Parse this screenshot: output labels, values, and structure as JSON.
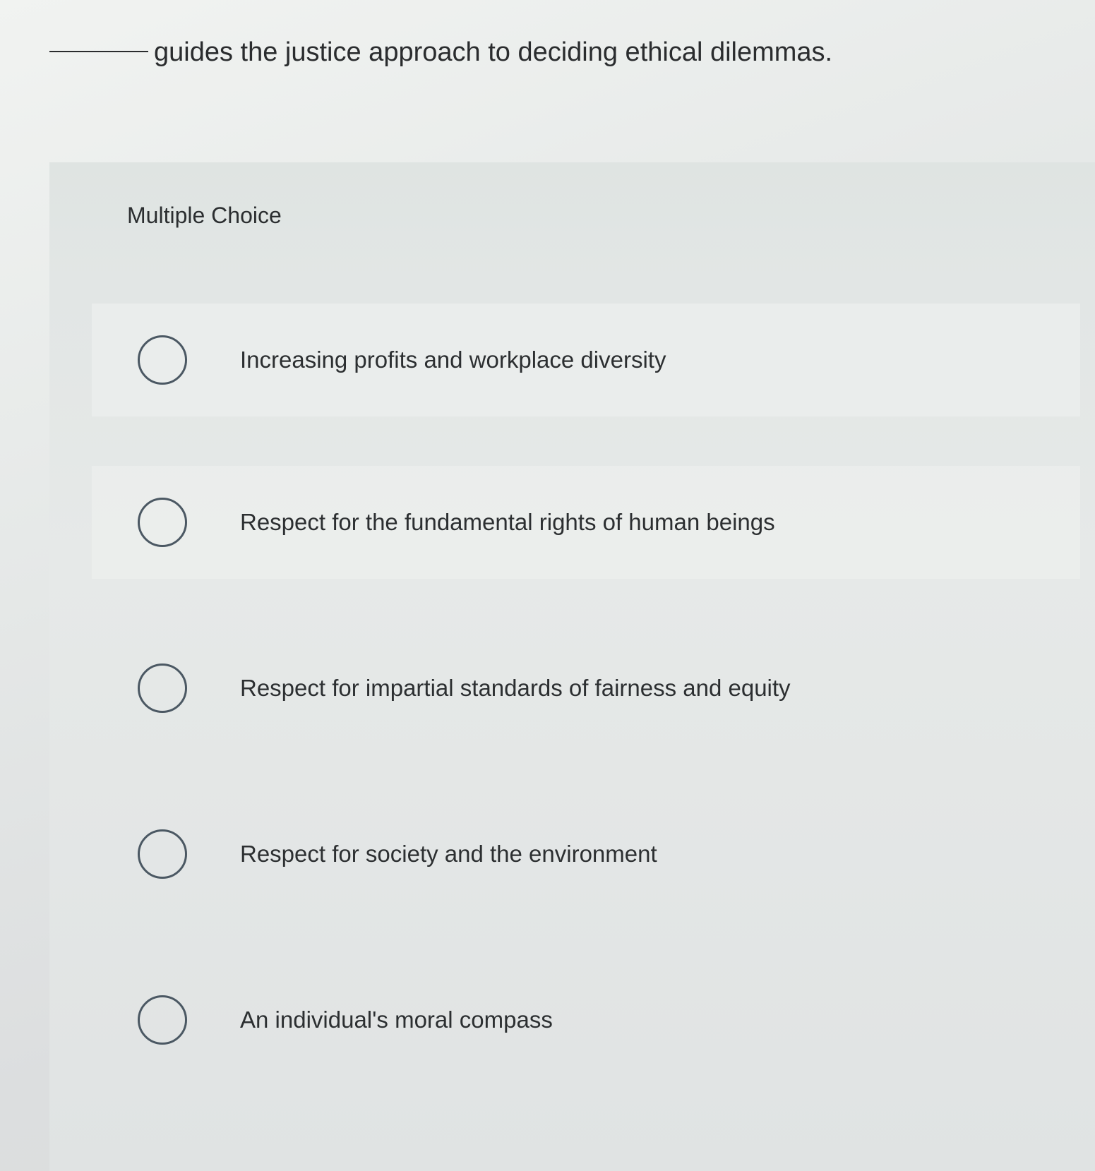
{
  "question": {
    "text": "guides the justice approach to deciding ethical dilemmas."
  },
  "section": {
    "label": "Multiple Choice"
  },
  "options": [
    {
      "label": "Increasing profits and workplace diversity"
    },
    {
      "label": "Respect for the fundamental rights of human beings"
    },
    {
      "label": "Respect for impartial standards of fairness and equity"
    },
    {
      "label": "Respect for society and the environment"
    },
    {
      "label": "An individual's moral compass"
    }
  ]
}
